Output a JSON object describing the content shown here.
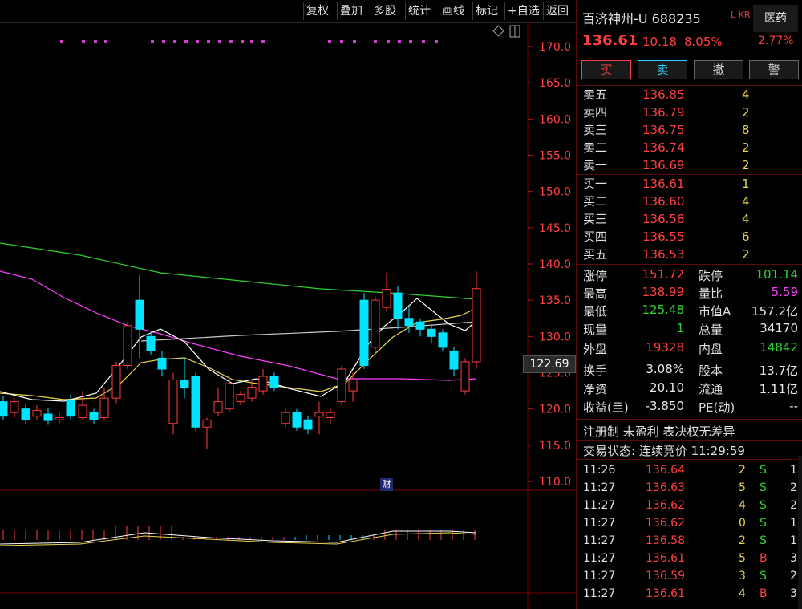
{
  "toolbar": {
    "items": [
      "复权",
      "叠加",
      "多股",
      "统计",
      "画线",
      "标记",
      "+自选",
      "返回"
    ]
  },
  "chart": {
    "y_ticks": [
      "170.0",
      "165.0",
      "160.0",
      "155.0",
      "150.0",
      "145.0",
      "140.0",
      "135.0",
      "130.0",
      "125.0",
      "120.0",
      "115.0",
      "110.0"
    ],
    "current_price_tag": "122.69",
    "event_badge": "财",
    "colors": {
      "up": "#ff3b3b",
      "down": "#00e5ff",
      "ma5": "#ffffff",
      "ma10": "#e8d44d",
      "ma20": "#ff40ff",
      "ma60": "#2ed42e",
      "ma120": "#c8c8c8"
    }
  },
  "quote": {
    "name": "百济神州-U",
    "code": "688235",
    "flag": "L KR",
    "sector": "医药",
    "sector_pct": "2.77%",
    "price": "136.61",
    "change": "10.18",
    "change_pct": "8.05%",
    "buttons": [
      "买",
      "卖",
      "撤",
      "警"
    ],
    "asks": [
      {
        "label": "卖五",
        "price": "136.85",
        "vol": "4"
      },
      {
        "label": "卖四",
        "price": "136.79",
        "vol": "2"
      },
      {
        "label": "卖三",
        "price": "136.75",
        "vol": "8"
      },
      {
        "label": "卖二",
        "price": "136.74",
        "vol": "2"
      },
      {
        "label": "卖一",
        "price": "136.69",
        "vol": "2"
      }
    ],
    "bids": [
      {
        "label": "买一",
        "price": "136.61",
        "vol": "1"
      },
      {
        "label": "买二",
        "price": "136.60",
        "vol": "4"
      },
      {
        "label": "买三",
        "price": "136.58",
        "vol": "4"
      },
      {
        "label": "买四",
        "price": "136.55",
        "vol": "6"
      },
      {
        "label": "买五",
        "price": "136.53",
        "vol": "2"
      }
    ],
    "stats1": {
      "limit_up_label": "涨停",
      "limit_up": "151.72",
      "limit_down_label": "跌停",
      "limit_down": "101.14",
      "high_label": "最高",
      "high": "138.99",
      "vol_ratio_label": "量比",
      "vol_ratio": "5.59",
      "low_label": "最低",
      "low": "125.48",
      "mcap_a_label": "市值A",
      "mcap_a": "157.2亿",
      "last_vol_label": "现量",
      "last_vol": "1",
      "total_vol_label": "总量",
      "total_vol": "34170",
      "outer_label": "外盘",
      "outer": "19328",
      "inner_label": "内盘",
      "inner": "14842"
    },
    "stats2": {
      "turnover_label": "换手",
      "turnover": "3.08%",
      "share_cap_label": "股本",
      "share_cap": "13.7亿",
      "nav_label": "净资",
      "nav": "20.10",
      "float_label": "流通",
      "float": "1.11亿",
      "eps_label": "收益(亖)",
      "eps": "-3.850",
      "pe_label": "PE(动)",
      "pe": "--"
    },
    "notes": "注册制 未盈利 表决权无差异",
    "trade_status": "交易状态: 连续竞价 11:29:59",
    "ticks": [
      {
        "time": "11:26",
        "price": "136.64",
        "vol": "2",
        "side": "S",
        "n": "1"
      },
      {
        "time": "11:27",
        "price": "136.63",
        "vol": "5",
        "side": "S",
        "n": "2"
      },
      {
        "time": "11:27",
        "price": "136.62",
        "vol": "4",
        "side": "S",
        "n": "2"
      },
      {
        "time": "11:27",
        "price": "136.62",
        "vol": "0",
        "side": "S",
        "n": "1"
      },
      {
        "time": "11:27",
        "price": "136.58",
        "vol": "2",
        "side": "S",
        "n": "1"
      },
      {
        "time": "11:27",
        "price": "136.61",
        "vol": "5",
        "side": "B",
        "n": "3"
      },
      {
        "time": "11:27",
        "price": "136.59",
        "vol": "3",
        "side": "S",
        "n": "2"
      },
      {
        "time": "11:27",
        "price": "136.61",
        "vol": "4",
        "side": "B",
        "n": "3"
      }
    ]
  }
}
